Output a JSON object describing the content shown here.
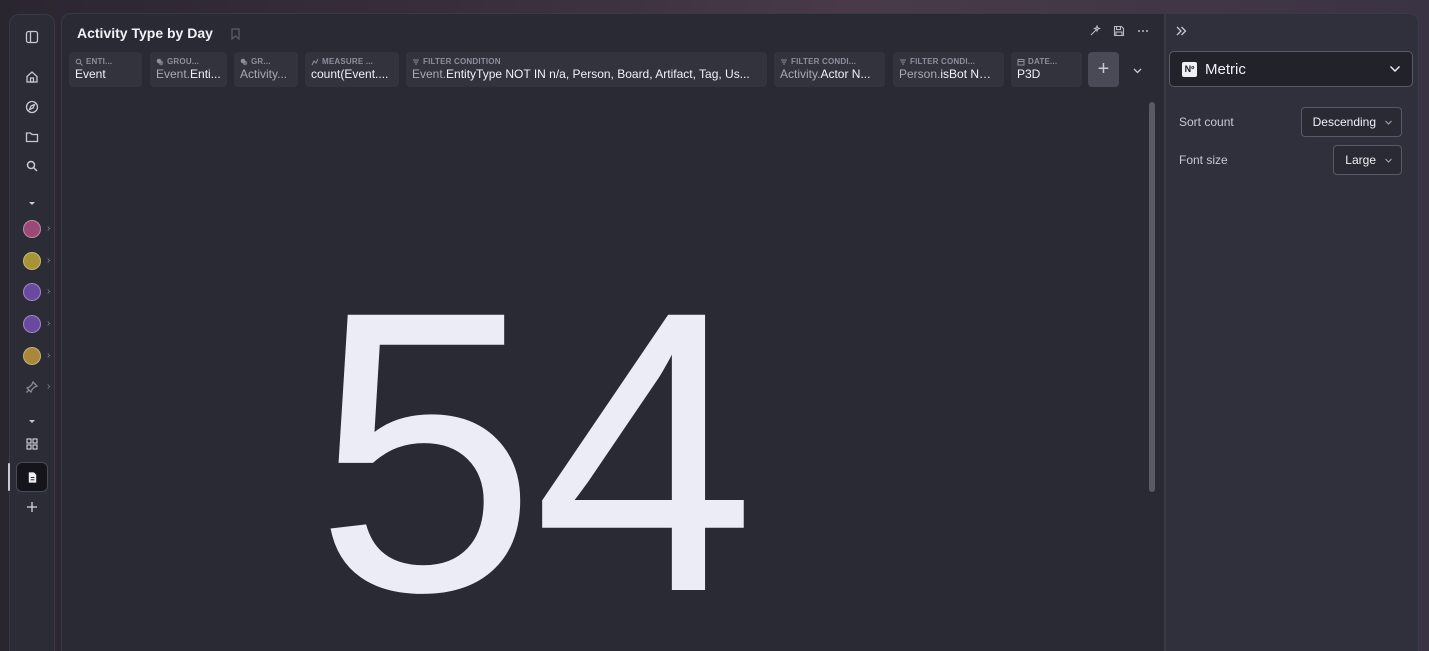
{
  "rail": {
    "dot_colors": [
      "#9b4a78",
      "#a89438",
      "#6a4aa0",
      "#6a4aa0",
      "#a8883a"
    ],
    "icons": [
      "sidebar-toggle-icon",
      "home-icon",
      "compass-icon",
      "folder-icon",
      "search-icon",
      "caret-down-icon",
      "pin-icon",
      "caret-down-icon",
      "grid-icon",
      "document-icon",
      "plus-icon"
    ]
  },
  "header": {
    "title": "Activity Type by Day",
    "icons": [
      "sparkle-icon",
      "save-icon",
      "more-icon"
    ]
  },
  "pills": [
    {
      "head": "ENTI...",
      "pre": "",
      "value": "Event"
    },
    {
      "head": "GROU...",
      "pre": "Event.",
      "value": "Enti..."
    },
    {
      "head": "GR...",
      "pre": "",
      "value": "Activity..."
    },
    {
      "head": "MEASURE ...",
      "pre": "count(Event.",
      "value": "..."
    },
    {
      "head": "FILTER CONDITION",
      "pre": "Event.",
      "value": "EntityType NOT IN n/a, Person, Board, Artifact, Tag, Us..."
    },
    {
      "head": "FILTER CONDI...",
      "pre": "Activity.",
      "value": "Actor N..."
    },
    {
      "head": "FILTER CONDI...",
      "pre": "Person.",
      "value": "isBot NO..."
    },
    {
      "head": "DATE...",
      "pre": "",
      "value": "P3D"
    }
  ],
  "metric": {
    "value": "54"
  },
  "panel": {
    "viz_badge": "Nº",
    "viz_label": "Metric",
    "sort_label": "Sort count",
    "sort_value": "Descending",
    "font_label": "Font size",
    "font_value": "Large"
  }
}
